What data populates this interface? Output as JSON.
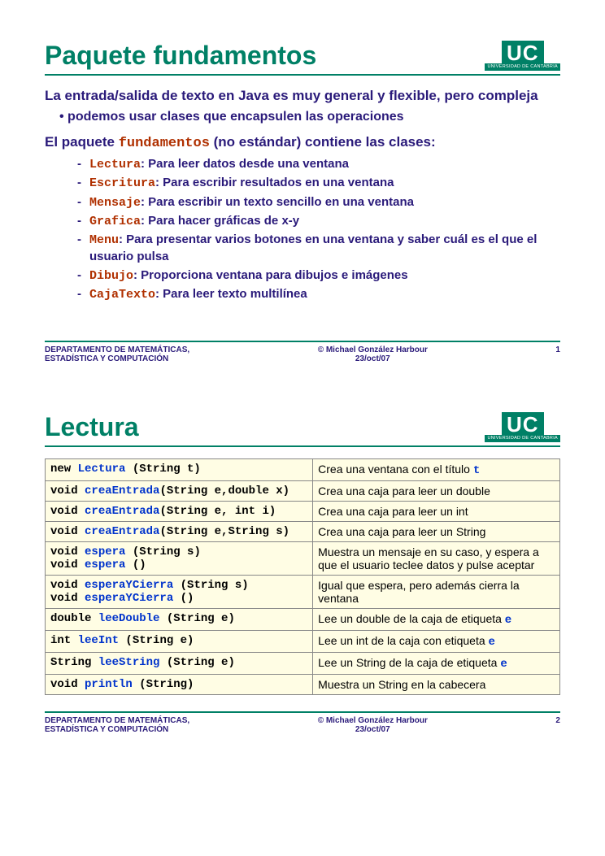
{
  "logo": {
    "main": "UC",
    "sub": "UNIVERSIDAD\nDE CANTABRIA"
  },
  "slide1": {
    "title": "Paquete fundamentos",
    "intro": "La entrada/salida de texto en Java es muy general y flexible, pero compleja",
    "sub": "podemos usar clases que encapsulen las operaciones",
    "intro2_pre": "El paquete ",
    "intro2_kw": "fundamentos",
    "intro2_post": " (no estándar) contiene las clases:",
    "classes": [
      {
        "name": "Lectura",
        "desc": ": Para leer datos desde una ventana"
      },
      {
        "name": "Escritura",
        "desc": ": Para escribir resultados en una ventana"
      },
      {
        "name": "Mensaje",
        "desc": ": Para escribir un texto sencillo en una ventana"
      },
      {
        "name": "Grafica",
        "desc": ": Para hacer gráficas de x-y"
      },
      {
        "name": "Menu",
        "desc": ": Para presentar varios botones en una ventana y saber cuál es el que el usuario pulsa"
      },
      {
        "name": "Dibujo",
        "desc": ": Proporciona ventana para dibujos e imágenes"
      },
      {
        "name": "CajaTexto",
        "desc": ": Para leer texto multilínea"
      }
    ],
    "footer": {
      "left1": "DEPARTAMENTO DE MATEMÁTICAS,",
      "left2": "ESTADÍSTICA Y COMPUTACIÓN",
      "center1": "© Michael González Harbour",
      "center2": "23/oct/07",
      "page": "1"
    }
  },
  "slide2": {
    "title": "Lectura",
    "rows": [
      {
        "sig_pre": "new ",
        "sig_m": "Lectura",
        "sig_post": " (String t)",
        "desc_pre": "Crea una ventana con el título ",
        "param": "t",
        "desc_post": ""
      },
      {
        "sig_pre": "void ",
        "sig_m": "creaEntrada",
        "sig_post": "(String e,double x)",
        "desc_pre": "Crea una caja para leer un double",
        "param": "",
        "desc_post": ""
      },
      {
        "sig_pre": "void ",
        "sig_m": "creaEntrada",
        "sig_post": "(String e, int i)",
        "desc_pre": "Crea una caja para leer un int",
        "param": "",
        "desc_post": ""
      },
      {
        "sig_pre": "void ",
        "sig_m": "creaEntrada",
        "sig_post": "(String e,String s)",
        "desc_pre": "Crea una caja para leer un String",
        "param": "",
        "desc_post": ""
      },
      {
        "sig_pre": "void ",
        "sig_m": "espera",
        "sig_post": " (String s)",
        "sig2_pre": "void ",
        "sig2_m": "espera",
        "sig2_post": " ()",
        "desc_pre": "Muestra un mensaje en su caso, y espera a que el usuario teclee datos y pulse aceptar",
        "param": "",
        "desc_post": ""
      },
      {
        "sig_pre": "void ",
        "sig_m": "esperaYCierra",
        "sig_post": " (String s)",
        "sig2_pre": "void ",
        "sig2_m": "esperaYCierra",
        "sig2_post": " ()",
        "desc_pre": "Igual que espera, pero además cierra la ventana",
        "param": "",
        "desc_post": ""
      },
      {
        "sig_pre": "double ",
        "sig_m": "leeDouble",
        "sig_post": " (String e)",
        "desc_pre": "Lee un double de la caja de etiqueta ",
        "param": "e",
        "desc_post": ""
      },
      {
        "sig_pre": "int ",
        "sig_m": "leeInt",
        "sig_post": " (String e)",
        "desc_pre": "Lee un int de la caja con etiqueta ",
        "param": "e",
        "desc_post": ""
      },
      {
        "sig_pre": "String ",
        "sig_m": "leeString",
        "sig_post": " (String e)",
        "desc_pre": "Lee un String de la caja de etiqueta ",
        "param": "e",
        "desc_post": ""
      },
      {
        "sig_pre": "void ",
        "sig_m": "println",
        "sig_post": " (String)",
        "desc_pre": "Muestra un String en la cabecera",
        "param": "",
        "desc_post": ""
      }
    ],
    "footer": {
      "left1": "DEPARTAMENTO DE MATEMÁTICAS,",
      "left2": "ESTADÍSTICA Y COMPUTACIÓN",
      "center1": "© Michael González Harbour",
      "center2": "23/oct/07",
      "page": "2"
    }
  }
}
